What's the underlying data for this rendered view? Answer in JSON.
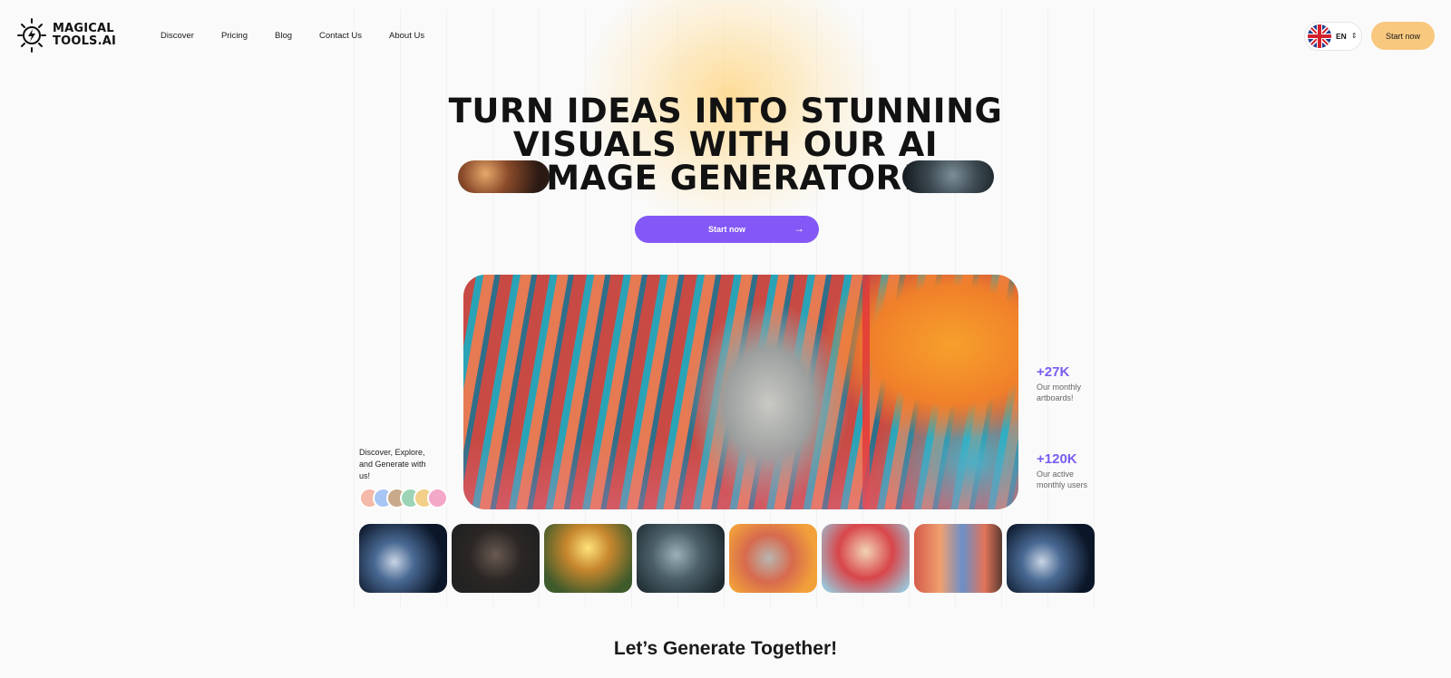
{
  "brand": {
    "line1": "MAGICAL",
    "line2": "TOOLS.AI",
    "icon": "lightning-sun-icon"
  },
  "nav": {
    "items": [
      "Discover",
      "Pricing",
      "Blog",
      "Contact Us",
      "About Us"
    ]
  },
  "header": {
    "language": "EN",
    "flag": "uk-flag-icon",
    "start_label": "Start now"
  },
  "hero": {
    "headline_lines": [
      "TURN IDEAS INTO STUNNING",
      "VISUALS WITH OUR AI",
      "IMAGE GENERATOR!"
    ],
    "cta_label": "Start now",
    "cta_icon": "arrow-right-icon",
    "main_image": "ai-generated-face-artwork",
    "side_text": "Discover, Explore, and Generate with us!"
  },
  "stats": [
    {
      "value": "+27K",
      "label": "Our monthly artboards!"
    },
    {
      "value": "+120K",
      "label": "Our active monthly users"
    }
  ],
  "gallery": [
    "spaceship",
    "dark-face",
    "meditating-monk",
    "armored-warrior",
    "patterned-face",
    "retro-car",
    "group-of-women",
    "spaceship"
  ],
  "colors": {
    "accent": "#8358f6",
    "button": "#f8c87f",
    "stat": "#7b5cf0",
    "background": "#fafafa"
  },
  "section": {
    "title": "Let’s Generate Together!"
  }
}
